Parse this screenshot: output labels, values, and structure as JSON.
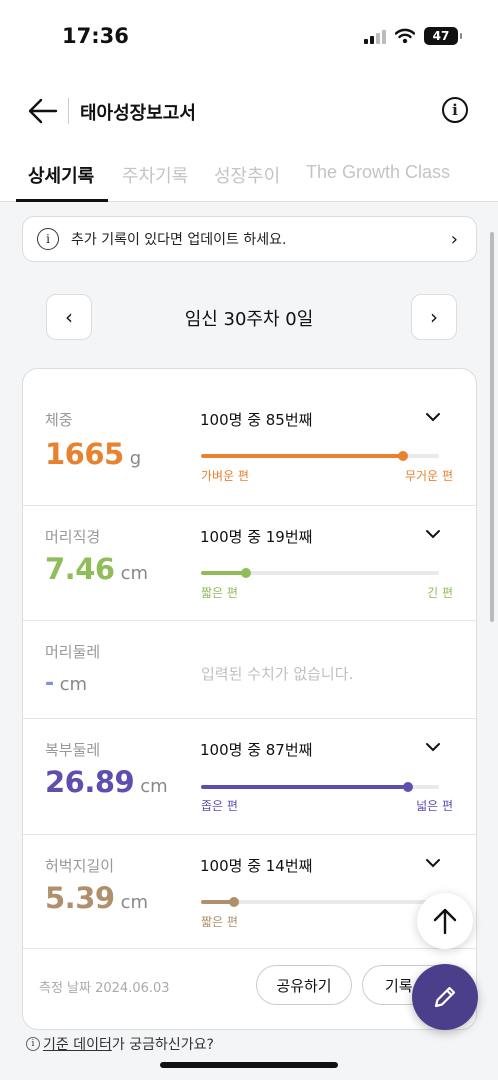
{
  "status_bar": {
    "time": "17:36",
    "battery": "47"
  },
  "header": {
    "title": "태아성장보고서"
  },
  "tabs": [
    {
      "label": "상세기록",
      "active": true
    },
    {
      "label": "주차기록",
      "active": false
    },
    {
      "label": "성장추이",
      "active": false
    },
    {
      "label": "The Growth Class",
      "active": false
    }
  ],
  "notice": {
    "text": "추가 기록이 있다면 업데이트 하세요."
  },
  "week": {
    "label": "임신 30주차 0일"
  },
  "metrics": [
    {
      "name": "체중",
      "value": "1665",
      "unit": "g",
      "rank": "100명 중 85번째",
      "percentile": 85,
      "color": "#e8822f",
      "left_label": "가벼운 편",
      "right_label": "무거운 편"
    },
    {
      "name": "머리직경",
      "value": "7.46",
      "unit": "cm",
      "rank": "100명 중 19번째",
      "percentile": 19,
      "color": "#8fbd5a",
      "left_label": "짧은 편",
      "right_label": "긴 편"
    },
    {
      "name": "머리둘레",
      "value": "-",
      "unit": "cm",
      "empty_text": "입력된 수치가 없습니다.",
      "color": "#7d8fe0"
    },
    {
      "name": "복부둘레",
      "value": "26.89",
      "unit": "cm",
      "rank": "100명 중 87번째",
      "percentile": 87,
      "color": "#5c4fb0",
      "left_label": "좁은 편",
      "right_label": "넓은 편"
    },
    {
      "name": "허벅지길이",
      "value": "5.39",
      "unit": "cm",
      "rank": "100명 중 14번째",
      "percentile": 14,
      "color": "#b0906c",
      "left_label": "짧은 편",
      "right_label": ""
    }
  ],
  "footer": {
    "measure_date": "측정 날짜 2024.06.03",
    "share_label": "공유하기",
    "record_label": "기록"
  },
  "bottom_link": {
    "link_text": "기준 데이터",
    "suffix": "가 궁금하신가요?"
  }
}
